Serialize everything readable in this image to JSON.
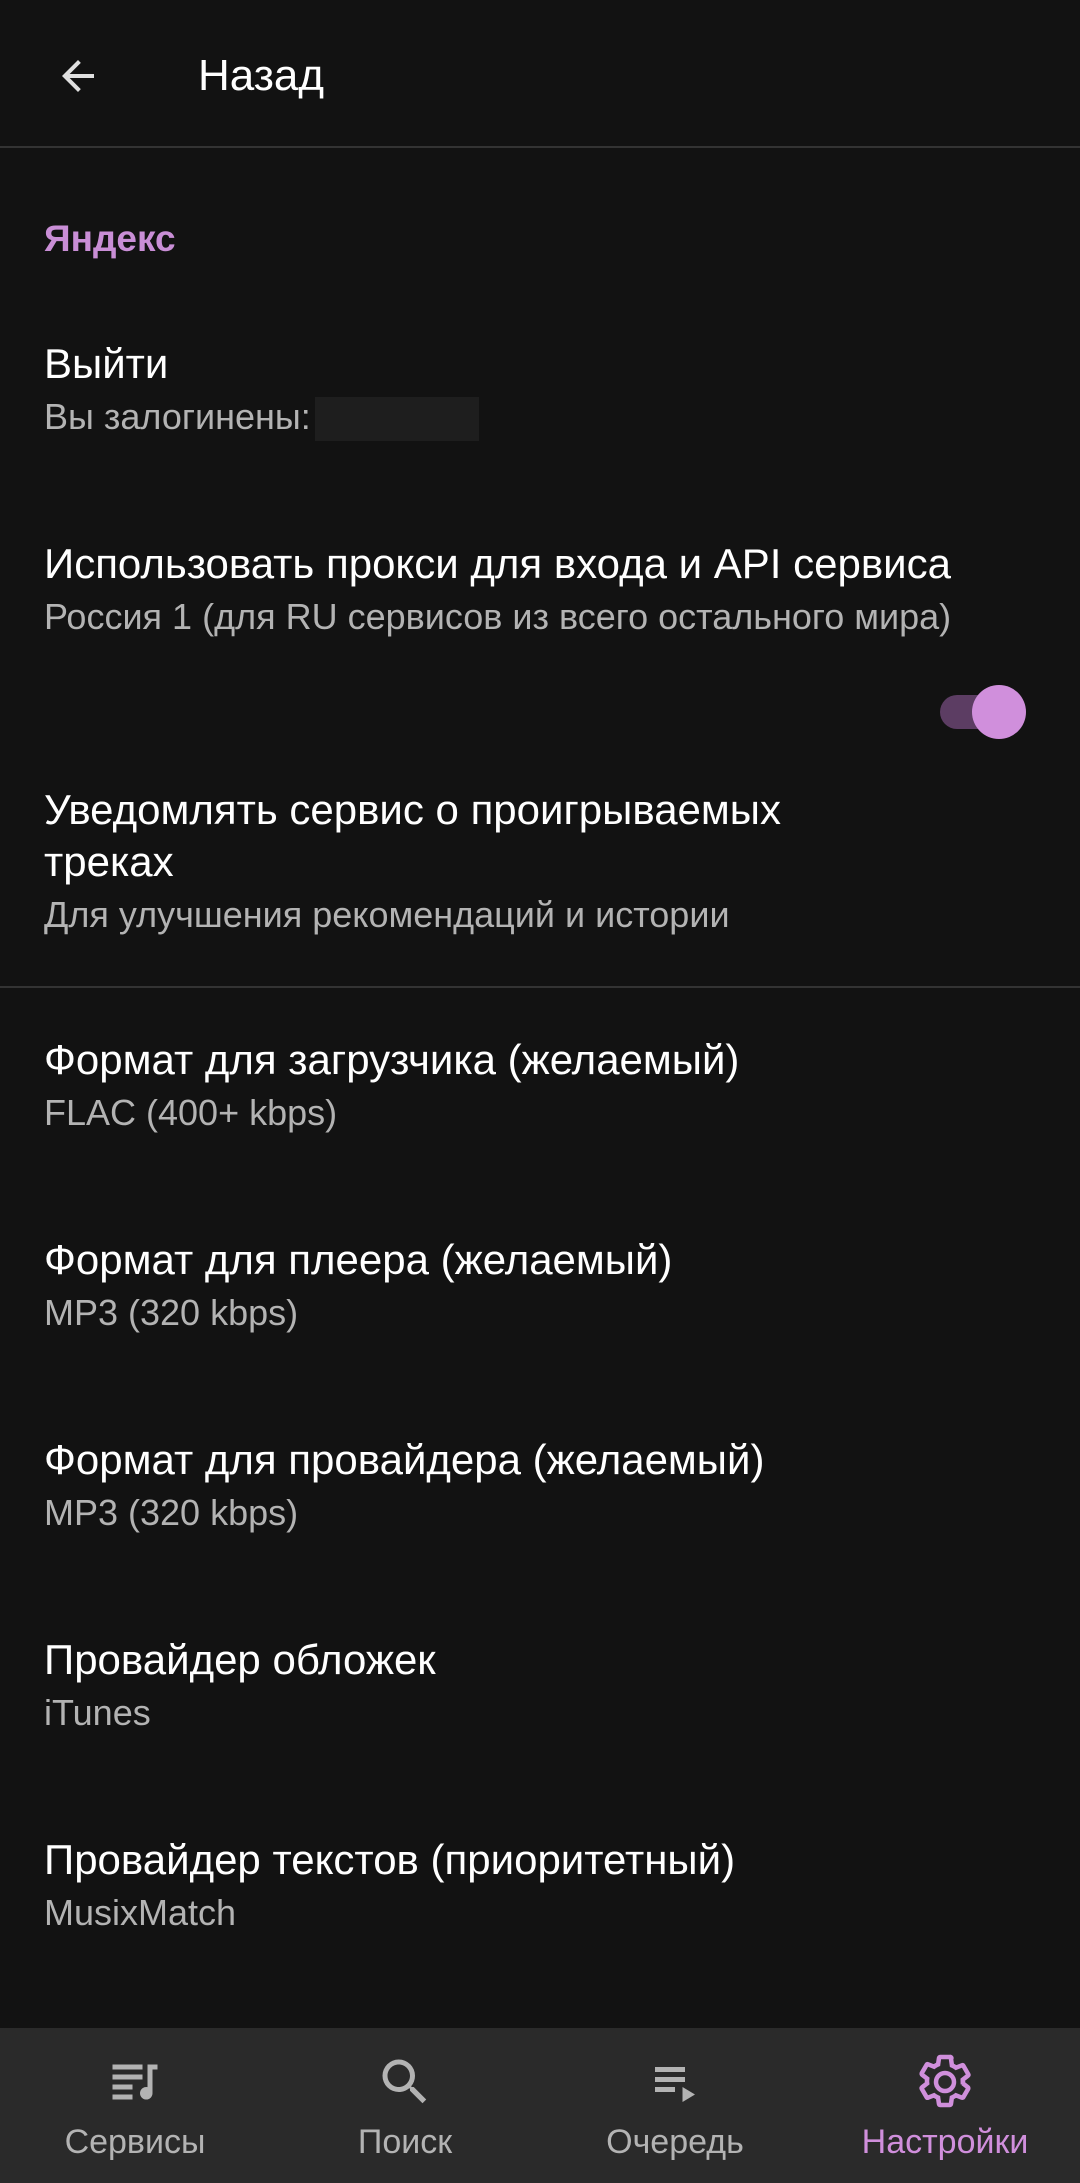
{
  "header": {
    "title": "Назад",
    "back_icon": "arrow-left-icon"
  },
  "colors": {
    "background": "#121212",
    "accent": "#d08fdc",
    "nav_background": "#2a2a2a"
  },
  "section": {
    "title": "Яндекс"
  },
  "items": [
    {
      "title": "Выйти",
      "subtitle": "Вы залогинены:"
    },
    {
      "title": "Использовать прокси для входа и API сервиса",
      "subtitle": "Россия 1 (для RU сервисов из всего остального мира)"
    },
    {
      "title": "Уведомлять сервис о проигрываемых треках",
      "subtitle": "Для улучшения рекомендаций и истории",
      "toggle_on": true
    },
    {
      "title": "Формат для загрузчика (желаемый)",
      "subtitle": "FLAC (400+ kbps)"
    },
    {
      "title": "Формат для плеера (желаемый)",
      "subtitle": "MP3 (320 kbps)"
    },
    {
      "title": "Формат для провайдера (желаемый)",
      "subtitle": "MP3 (320 kbps)"
    },
    {
      "title": "Провайдер обложек",
      "subtitle": "iTunes"
    },
    {
      "title": "Провайдер текстов (приоритетный)",
      "subtitle": "MusixMatch"
    }
  ],
  "nav": {
    "active": "settings",
    "items": [
      {
        "label": "Сервисы",
        "icon": "library-music-icon"
      },
      {
        "label": "Поиск",
        "icon": "search-icon"
      },
      {
        "label": "Очередь",
        "icon": "queue-icon"
      },
      {
        "label": "Настройки",
        "icon": "gear-icon"
      }
    ]
  }
}
